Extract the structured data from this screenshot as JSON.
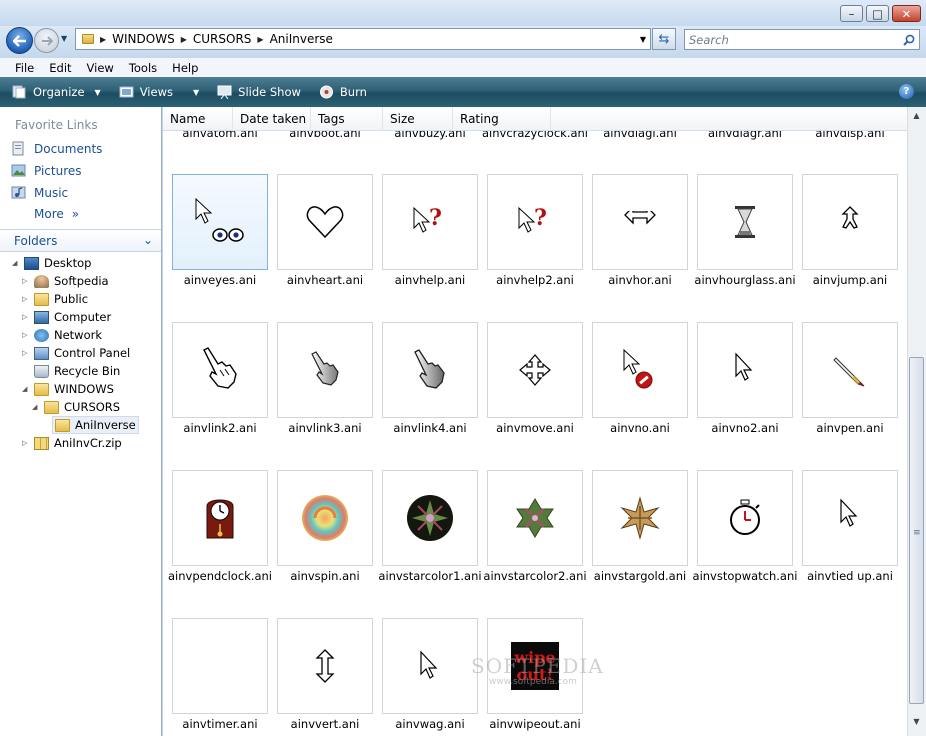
{
  "window": {
    "title": "",
    "controls": {
      "minimize": "–",
      "maximize": "□",
      "close": "✕"
    }
  },
  "nav": {
    "breadcrumb": [
      "WINDOWS",
      "CURSORS",
      "AniInverse"
    ],
    "search_placeholder": "Search",
    "icons": {
      "back": "back-arrow-icon",
      "forward": "forward-arrow-icon",
      "refresh": "refresh-icon",
      "search": "magnifier-icon"
    }
  },
  "menubar": [
    "File",
    "Edit",
    "View",
    "Tools",
    "Help"
  ],
  "toolbar": {
    "organize": "Organize",
    "views": "Views",
    "slideshow": "Slide Show",
    "burn": "Burn"
  },
  "navpane": {
    "favorite_header": "Favorite Links",
    "favorites": [
      "Documents",
      "Pictures",
      "Music"
    ],
    "more": "More",
    "folders_header": "Folders",
    "tree": [
      "Desktop",
      "Softpedia",
      "Public",
      "Computer",
      "Network",
      "Control Panel",
      "Recycle Bin",
      "WINDOWS",
      "CURSORS",
      "AniInverse",
      "AniInvCr.zip"
    ]
  },
  "columns": [
    "Name",
    "Date taken",
    "Tags",
    "Size",
    "Rating"
  ],
  "partial_row": [
    "ainvatom.ani",
    "ainvboot.ani",
    "ainvbuzy.ani",
    "ainvcrazyclock.ani",
    "ainvdiagl.ani",
    "ainvdiagr.ani",
    "ainvdisp.ani"
  ],
  "files": [
    "ainveyes.ani",
    "ainvheart.ani",
    "ainvhelp.ani",
    "ainvhelp2.ani",
    "ainvhor.ani",
    "ainvhourglass.ani",
    "ainvjump.ani",
    "ainvlink2.ani",
    "ainvlink3.ani",
    "ainvlink4.ani",
    "ainvmove.ani",
    "ainvno.ani",
    "ainvno2.ani",
    "ainvpen.ani",
    "ainvpendclock.ani",
    "ainvspin.ani",
    "ainvstarcolor1.ani",
    "ainvstarcolor2.ani",
    "ainvstargold.ani",
    "ainvstopwatch.ani",
    "ainvtied up.ani",
    "ainvtimer.ani",
    "ainvvert.ani",
    "ainvwag.ani",
    "ainvwipeout.ani"
  ],
  "selected_file": "ainveyes.ani",
  "wipeout_text": [
    "wipe",
    "out!"
  ],
  "watermark": "SOFTPEDIA",
  "watermark_url": "www.softpedia.com",
  "colors": {
    "toolbar": "#2d6076",
    "link": "#1c4f96",
    "selection": "#7fb2e0"
  }
}
